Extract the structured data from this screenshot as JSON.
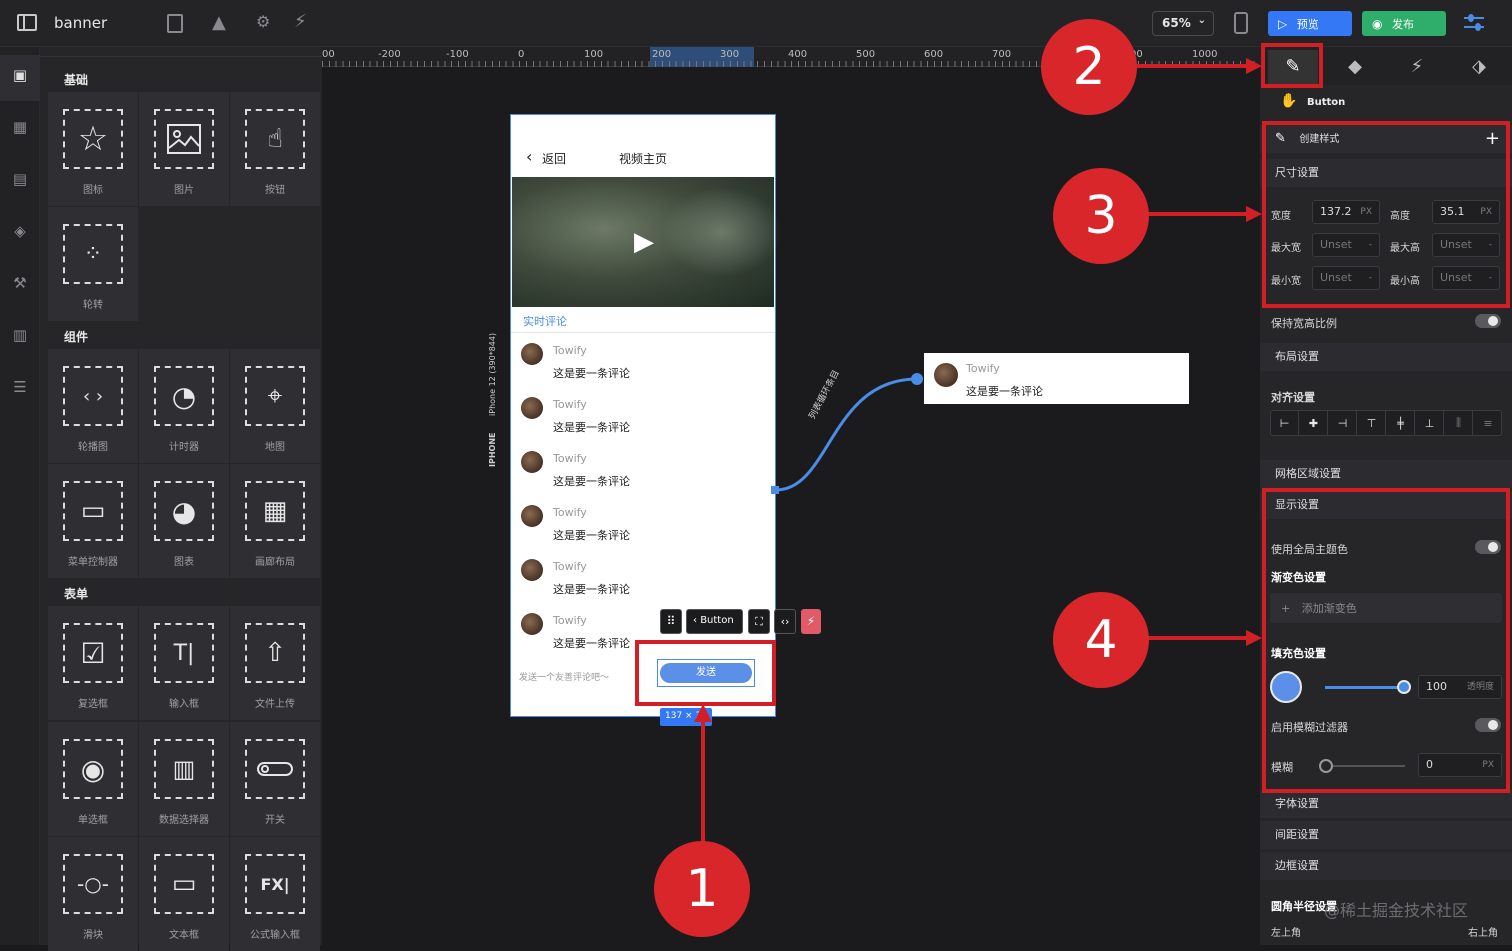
{
  "app": {
    "title": "banner",
    "zoom": "65%",
    "preview_label": "预览",
    "publish_label": "发布"
  },
  "ruler": {
    "ticks": [
      "00",
      "-200",
      "-100",
      "0",
      "100",
      "200",
      "300",
      "400",
      "500",
      "600",
      "700",
      "00",
      "1000"
    ]
  },
  "palette": {
    "sections": [
      {
        "title": "基础",
        "items": [
          "图标",
          "图片",
          "按钮",
          "轮转"
        ]
      },
      {
        "title": "组件",
        "items": [
          "轮播图",
          "计时器",
          "地图",
          "菜单控制器",
          "图表",
          "画廊布局"
        ]
      },
      {
        "title": "表单",
        "items": [
          "复选框",
          "输入框",
          "文件上传",
          "单选框",
          "数据选择器",
          "开关",
          "滑块",
          "文本框",
          "公式输入框"
        ]
      }
    ]
  },
  "phone": {
    "device_label": "IPHONE",
    "device_sub": "iPhone 12 (390*844)",
    "back_label": "返回",
    "page_title": "视频主页",
    "section_label": "实时评论",
    "comments": [
      {
        "user": "Towify",
        "text": "这是要一条评论"
      },
      {
        "user": "Towify",
        "text": "这是要一条评论"
      },
      {
        "user": "Towify",
        "text": "这是要一条评论"
      },
      {
        "user": "Towify",
        "text": "这是要一条评论"
      },
      {
        "user": "Towify",
        "text": "这是要一条评论"
      },
      {
        "user": "Towify",
        "text": "这是要一条评论"
      }
    ],
    "input_placeholder": "发送一个友善评论吧～",
    "send_label": "发送",
    "size_readout": "137 × 3",
    "toolbar_button_label": "Button"
  },
  "connector": {
    "label": "列表循环条目"
  },
  "preview_card": {
    "user": "Towify",
    "text": "这是要一条评论"
  },
  "callouts": [
    "1",
    "2",
    "3",
    "4"
  ],
  "props": {
    "element_name": "Button",
    "create_style": "创建样式",
    "size_section": "尺寸设置",
    "width_label": "宽度",
    "width_value": "137.2",
    "width_unit": "PX",
    "height_label": "高度",
    "height_value": "35.1",
    "height_unit": "PX",
    "max_width_label": "最大宽",
    "max_height_label": "最大高",
    "min_width_label": "最小宽",
    "min_height_label": "最小高",
    "unset": "Unset",
    "unset_suffix": "-",
    "keep_ratio": "保持宽高比例",
    "layout_section": "布局设置",
    "align_section": "对齐设置",
    "grid_section": "网格区域设置",
    "display_section": "显示设置",
    "use_theme_color": "使用全局主题色",
    "gradient_section": "渐变色设置",
    "add_gradient": "添加渐变色",
    "fill_section": "填充色设置",
    "fill_value": "100",
    "fill_unit": "透明度",
    "blur_filter": "启用模糊过滤器",
    "blur_label": "模糊",
    "blur_value": "0",
    "blur_unit": "PX",
    "font_section": "字体设置",
    "spacing_section": "间距设置",
    "border_section": "边框设置",
    "radius_section": "圆角半径设置",
    "top_left": "左上角",
    "top_right": "右上角",
    "watermark": "@稀土掘金技术社区"
  },
  "colors": {
    "accent": "#4a8de6",
    "publish": "#2fae6b",
    "preview": "#3478f6",
    "callout": "#d9262b"
  }
}
